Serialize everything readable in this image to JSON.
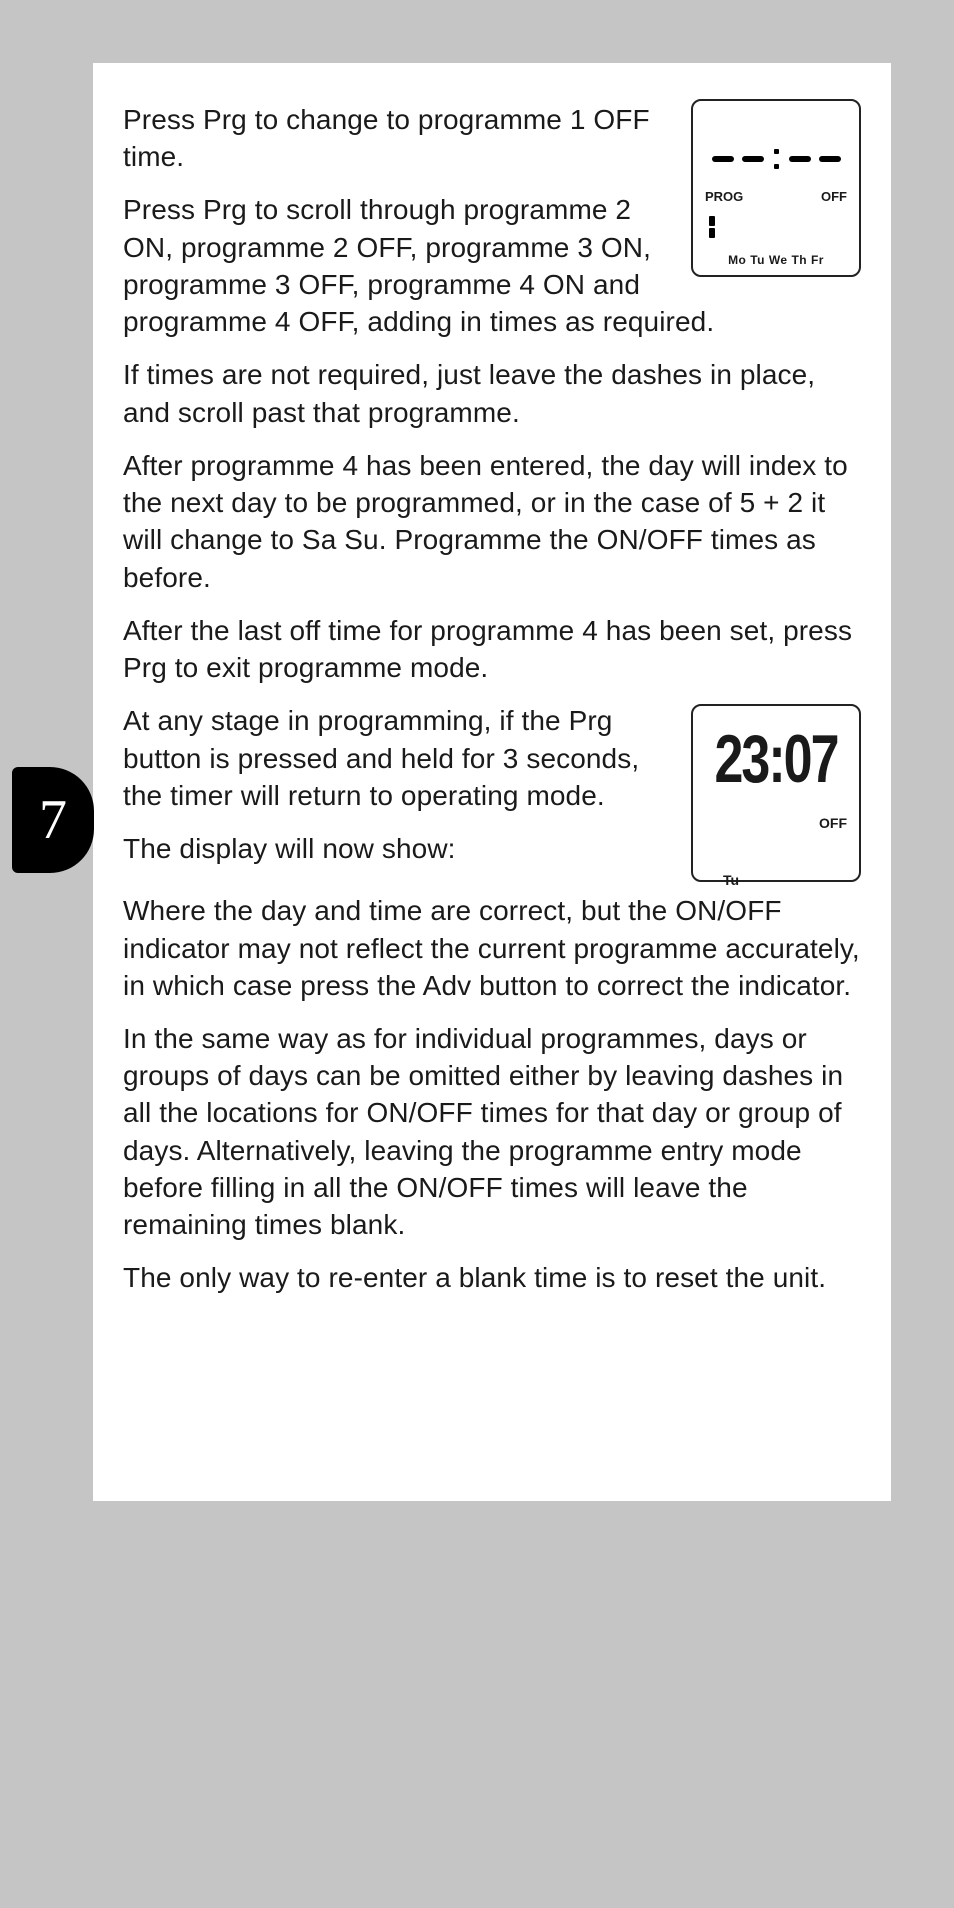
{
  "page_number": "7",
  "paragraphs": {
    "p1": "Press Prg to change to programme 1 OFF time.",
    "p2": "Press Prg to scroll through programme 2 ON, programme 2 OFF, programme 3 ON, programme 3 OFF, programme 4 ON and programme 4 OFF, adding in times as required.",
    "p3": "If times are not required, just leave the dashes in place, and scroll past that programme.",
    "p4": "After programme 4 has been entered, the day will index to the next day to be programmed, or in the case of 5 + 2 it will change to Sa Su. Programme the ON/OFF times as before.",
    "p5": "After the last off time for programme 4 has been set, press Prg to exit programme mode.",
    "p6": "At any stage in programming, if the Prg button is pressed and held for 3 seconds, the timer will return to operating mode.",
    "p7": "The display will now show:",
    "p8": "Where the day and time are correct, but the ON/OFF indicator may not reflect the current programme accurately, in which case press the Adv button to correct the indicator.",
    "p9": "In the same way as for individual programmes, days or groups of days can be omitted either by leaving dashes in all the locations for ON/OFF times for that day or group of days. Alternatively, leaving the programme entry mode before filling in all the ON/OFF times will leave the remaining times blank.",
    "p10": "The only way to re-enter a blank time is to reset the unit."
  },
  "lcd1": {
    "prog_label": "PROG",
    "off_label": "OFF",
    "days": "Mo Tu We Th Fr"
  },
  "lcd2": {
    "time": "23:07",
    "off_label": "OFF",
    "day": "Tu"
  }
}
